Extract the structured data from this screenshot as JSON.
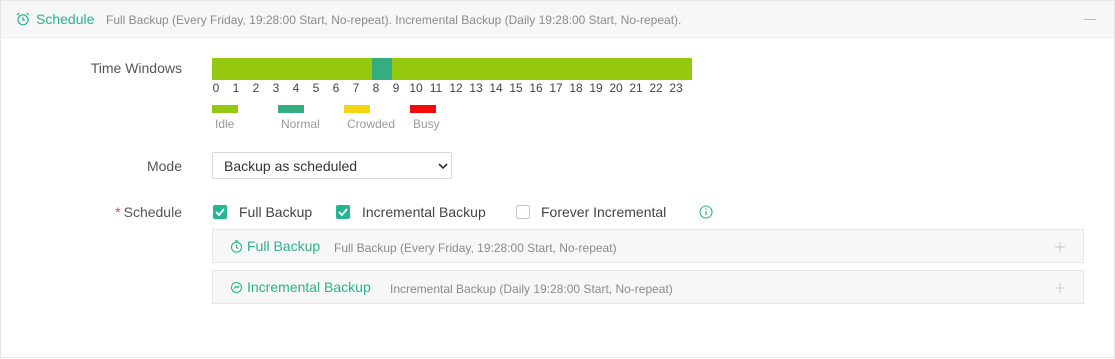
{
  "header": {
    "title": "Schedule",
    "summary": "Full Backup (Every Friday, 19:28:00 Start, No-repeat). Incremental Backup (Daily 19:28:00 Start, No-repeat)."
  },
  "time_windows": {
    "label": "Time Windows",
    "hours": [
      "0",
      "1",
      "2",
      "3",
      "4",
      "5",
      "6",
      "7",
      "8",
      "9",
      "10",
      "11",
      "12",
      "13",
      "14",
      "15",
      "16",
      "17",
      "18",
      "19",
      "20",
      "21",
      "22",
      "23"
    ],
    "hour_status": [
      "idle",
      "idle",
      "idle",
      "idle",
      "idle",
      "idle",
      "idle",
      "idle",
      "normal",
      "idle",
      "idle",
      "idle",
      "idle",
      "idle",
      "idle",
      "idle",
      "idle",
      "idle",
      "idle",
      "idle",
      "idle",
      "idle",
      "idle",
      "idle"
    ],
    "legend": [
      {
        "key": "idle",
        "label": "Idle",
        "color": "#95c90f"
      },
      {
        "key": "normal",
        "label": "Normal",
        "color": "#35ad80"
      },
      {
        "key": "crowded",
        "label": "Crowded",
        "color": "#f5d414"
      },
      {
        "key": "busy",
        "label": "Busy",
        "color": "#f00a0a"
      }
    ]
  },
  "mode": {
    "label": "Mode",
    "selected": "Backup as scheduled"
  },
  "schedule": {
    "label": "Schedule",
    "options": [
      {
        "label": "Full Backup",
        "checked": true
      },
      {
        "label": "Incremental Backup",
        "checked": true
      },
      {
        "label": "Forever Incremental",
        "checked": false
      }
    ],
    "info_icon": "info-circle-icon",
    "panels": [
      {
        "title": "Full Backup",
        "desc": "Full Backup (Every Friday, 19:28:00 Start, No-repeat)",
        "icon": "timer-icon"
      },
      {
        "title": "Incremental Backup",
        "desc": "Incremental Backup (Daily 19:28:00 Start, No-repeat)",
        "icon": "cycle-icon"
      }
    ]
  },
  "colors": {
    "accent": "#2bb38b",
    "checkbox": "#25b592"
  }
}
